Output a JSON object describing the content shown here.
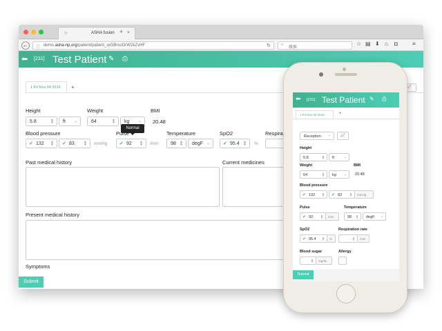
{
  "browser": {
    "tab_title": "ASHA fusion",
    "tab_favicon": "↻",
    "new_tab": "+",
    "url_prefix": "demo.",
    "url_domain": "asha-np.org",
    "url_path": "/patient/patient_qrGBrxoOrW2kZvHF",
    "search_placeholder": "検索"
  },
  "app": {
    "patient_id": "[231]",
    "patient_name": "Test Patient",
    "record_tab": "1  Fri Nov 04 2016",
    "add_tab": "+",
    "tooltip": "Normal",
    "submit_label": "Submit",
    "fields": {
      "height": {
        "label": "Height",
        "value": "5.8",
        "unit": "ft"
      },
      "weight": {
        "label": "Weight",
        "value": "64",
        "unit": "kg"
      },
      "bmi": {
        "label": "BMI",
        "value": "20.48"
      },
      "blood_pressure": {
        "label": "Blood pressure",
        "systolic": "132",
        "diastolic": "83",
        "unit": "mmHg"
      },
      "pulse": {
        "label": "Pulse",
        "value": "92",
        "unit": "/min"
      },
      "temperature": {
        "label": "Temperature",
        "value": "98",
        "unit": "degF"
      },
      "spo2": {
        "label": "SpO2",
        "value": "95.4",
        "unit": "%"
      },
      "respiration": {
        "label": "Respiration rate",
        "label_truncated": "Respiratio",
        "unit": "/min"
      },
      "blood_sugar": {
        "label": "Blood sugar",
        "unit": "mg/dL"
      },
      "allergy": {
        "label": "Allergy"
      }
    },
    "sections": {
      "past_history": "Past medical history",
      "current_medicines": "Current medicines",
      "present_history": "Present medical history",
      "symptoms": "Symptoms"
    },
    "mobile_form_select": "Reception"
  },
  "colors": {
    "accent": "#3fb28f",
    "accent_light": "#4ecdb4"
  }
}
